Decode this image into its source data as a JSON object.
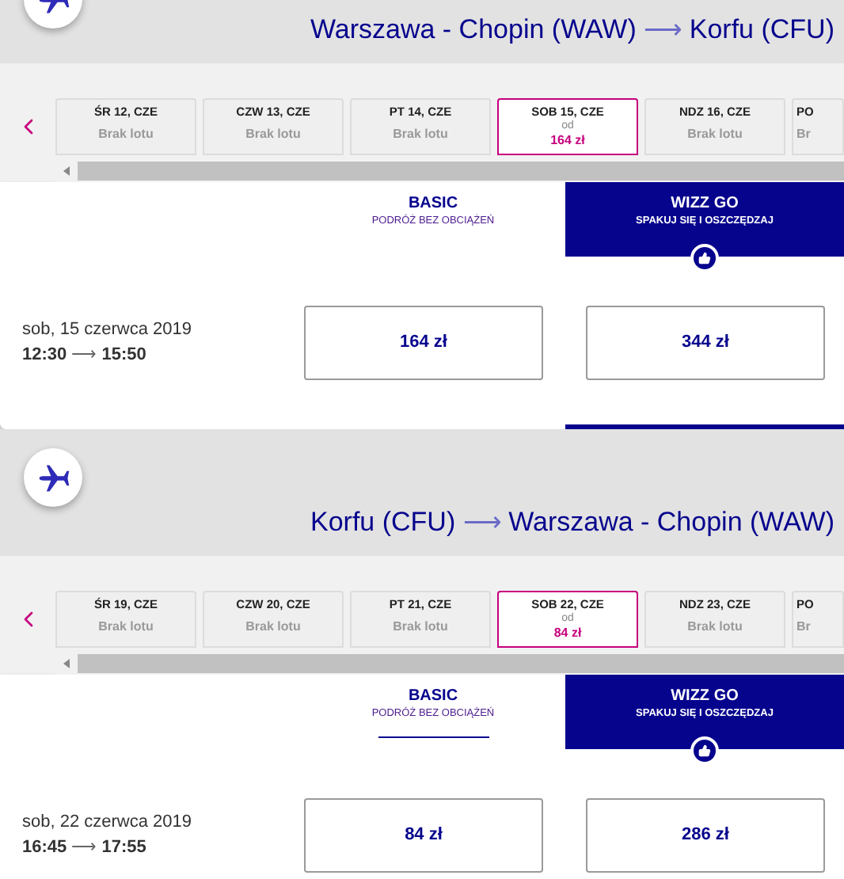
{
  "sections": [
    {
      "route": {
        "origin": "Warszawa - Chopin (WAW)",
        "arrow": "⟶",
        "destination": "Korfu (CFU)"
      },
      "dates": [
        {
          "label": "ŚR 12, CZE",
          "status": "Brak lotu",
          "selected": false
        },
        {
          "label": "CZW 13, CZE",
          "status": "Brak lotu",
          "selected": false
        },
        {
          "label": "PT 14, CZE",
          "status": "Brak lotu",
          "selected": false
        },
        {
          "label": "SOB 15, CZE",
          "from": "od",
          "price": "164 zł",
          "selected": true
        },
        {
          "label": "NDZ 16, CZE",
          "status": "Brak lotu",
          "selected": false
        },
        {
          "label": "PO",
          "status": "Br",
          "selected": false
        }
      ],
      "fares": [
        {
          "name": "BASIC",
          "tagline": "PODRÓŻ BEZ OBCIĄŻEŃ",
          "highlighted": false,
          "underlined": false
        },
        {
          "name": "WIZZ GO",
          "tagline": "SPAKUJ SIĘ I OSZCZĘDZAJ",
          "highlighted": true,
          "underlined": false
        }
      ],
      "flight": {
        "date": "sob, 15 czerwca 2019",
        "departure": "12:30",
        "arrow": "⟶",
        "arrival": "15:50",
        "prices": [
          "164 zł",
          "344 zł"
        ]
      }
    },
    {
      "route": {
        "origin": "Korfu (CFU)",
        "arrow": "⟶",
        "destination": "Warszawa - Chopin (WAW)"
      },
      "dates": [
        {
          "label": "ŚR 19, CZE",
          "status": "Brak lotu",
          "selected": false
        },
        {
          "label": "CZW 20, CZE",
          "status": "Brak lotu",
          "selected": false
        },
        {
          "label": "PT 21, CZE",
          "status": "Brak lotu",
          "selected": false
        },
        {
          "label": "SOB 22, CZE",
          "from": "od",
          "price": "84 zł",
          "selected": true
        },
        {
          "label": "NDZ 23, CZE",
          "status": "Brak lotu",
          "selected": false
        },
        {
          "label": "PO",
          "status": "Br",
          "selected": false
        }
      ],
      "fares": [
        {
          "name": "BASIC",
          "tagline": "PODRÓŻ BEZ OBCIĄŻEŃ",
          "highlighted": false,
          "underlined": true
        },
        {
          "name": "WIZZ GO",
          "tagline": "SPAKUJ SIĘ I OSZCZĘDZAJ",
          "highlighted": true,
          "underlined": false
        }
      ],
      "flight": {
        "date": "sob, 22 czerwca 2019",
        "departure": "16:45",
        "arrow": "⟶",
        "arrival": "17:55",
        "prices": [
          "84 zł",
          "286 zł"
        ]
      }
    }
  ]
}
